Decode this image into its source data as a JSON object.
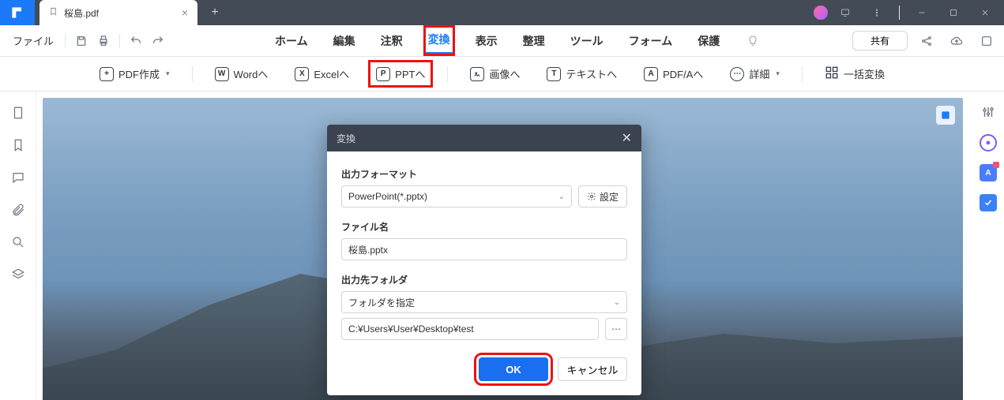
{
  "titlebar": {
    "tab_title": "桜島.pdf",
    "new_tab_plus": "+"
  },
  "menubar": {
    "file": "ファイル",
    "tabs": [
      "ホーム",
      "編集",
      "注釈",
      "変換",
      "表示",
      "整理",
      "ツール",
      "フォーム",
      "保護"
    ],
    "active_index": 3,
    "share": "共有"
  },
  "toolbar": {
    "pdf_create": "PDF作成",
    "to_word": "Wordへ",
    "to_excel": "Excelへ",
    "to_ppt": "PPTへ",
    "to_image": "画像へ",
    "to_text": "テキストへ",
    "to_pdfa": "PDF/Aへ",
    "detail": "詳細",
    "batch": "一括変換"
  },
  "dialog": {
    "title": "変換",
    "format_label": "出力フォーマット",
    "format_value": "PowerPoint(*.pptx)",
    "settings": "設定",
    "filename_label": "ファイル名",
    "filename_value": "桜島.pptx",
    "outfolder_label": "出力先フォルダ",
    "outfolder_mode": "フォルダを指定",
    "outfolder_path": "C:¥Users¥User¥Desktop¥test",
    "ok": "OK",
    "cancel": "キャンセル"
  }
}
